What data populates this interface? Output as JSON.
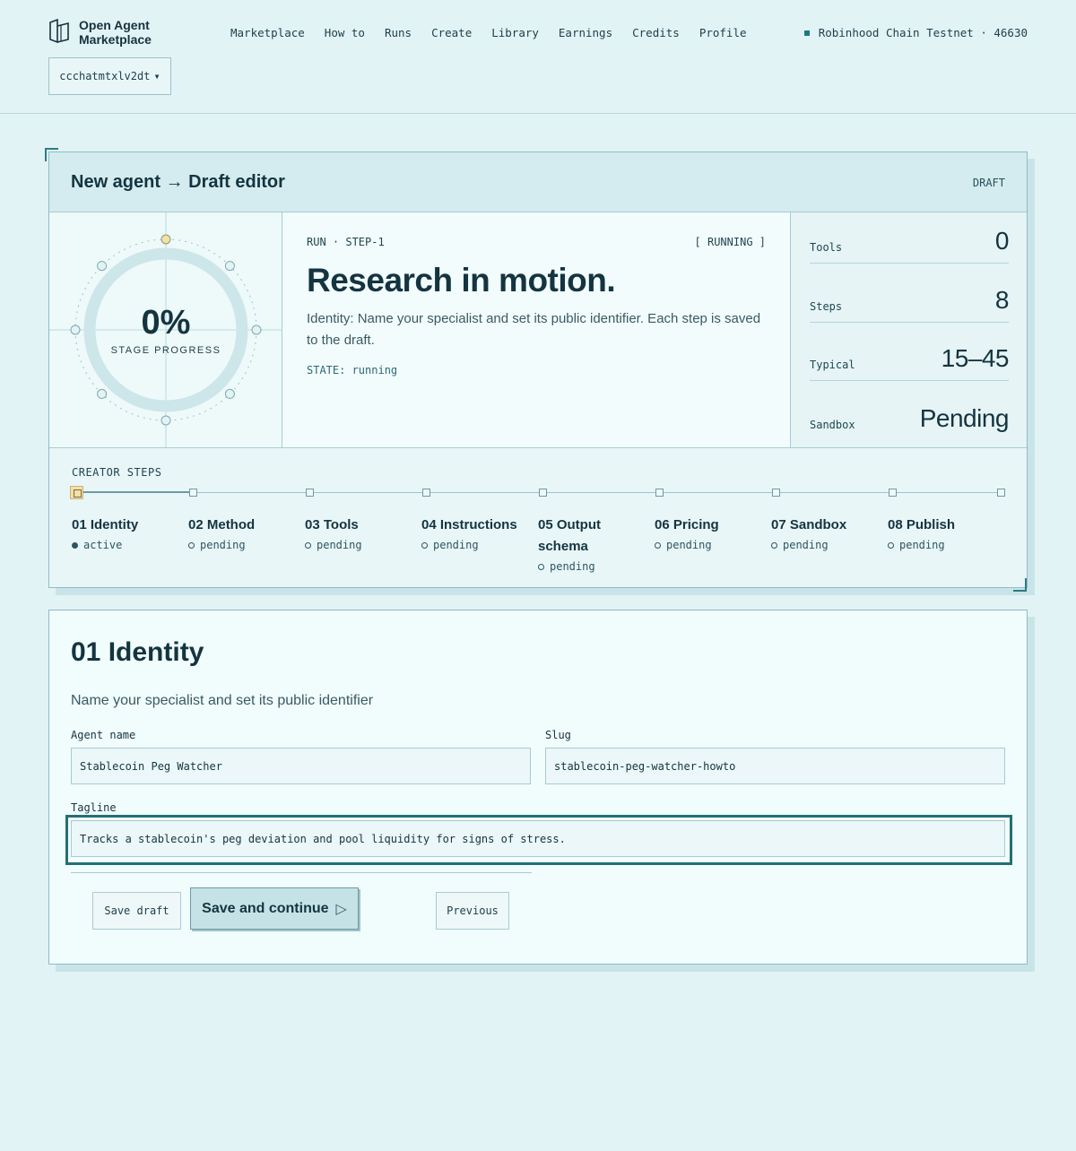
{
  "header": {
    "logo_line1": "Open Agent",
    "logo_line2": "Marketplace",
    "nav": [
      "Marketplace",
      "How to",
      "Runs",
      "Create",
      "Library",
      "Earnings",
      "Credits",
      "Profile"
    ],
    "chain": "Robinhood Chain Testnet · 46630",
    "account": "ccchatmtxlv2dt",
    "account_caret": "▾"
  },
  "editor": {
    "title": "New agent → Draft editor",
    "badge": "DRAFT",
    "progress": "0%",
    "progress_label": "STAGE PROGRESS",
    "run_label": "RUN · STEP-1",
    "run_status": "[ RUNNING ]",
    "headline": "Research in motion.",
    "description": "Identity: Name your specialist and set its public identifier. Each step is saved to the draft.",
    "state": "STATE: running",
    "stats": [
      {
        "key": "Tools",
        "value": "0"
      },
      {
        "key": "Steps",
        "value": "8"
      },
      {
        "key": "Typical",
        "value": "15–45"
      },
      {
        "key": "Sandbox",
        "value": "Pending"
      }
    ],
    "steps_title": "CREATOR STEPS",
    "steps": [
      {
        "name": "01 Identity",
        "status": "active"
      },
      {
        "name": "02 Method",
        "status": "pending"
      },
      {
        "name": "03 Tools",
        "status": "pending"
      },
      {
        "name": "04 Instructions",
        "status": "pending"
      },
      {
        "name": "05 Output schema",
        "status": "pending"
      },
      {
        "name": "06 Pricing",
        "status": "pending"
      },
      {
        "name": "07 Sandbox",
        "status": "pending"
      },
      {
        "name": "08 Publish",
        "status": "pending"
      }
    ]
  },
  "form": {
    "title": "01 Identity",
    "subtitle": "Name your specialist and set its public identifier",
    "agent_name_label": "Agent name",
    "agent_name_value": "Stablecoin Peg Watcher",
    "slug_label": "Slug",
    "slug_value": "stablecoin-peg-watcher-howto",
    "tagline_label": "Tagline",
    "tagline_value": "Tracks a stablecoin's peg deviation and pool liquidity for signs of stress.",
    "save_draft": "Save draft",
    "save_continue": "Save and continue",
    "save_continue_icon": "▷",
    "previous": "Previous"
  },
  "colors": {
    "background": "#e2f3f6",
    "accent": "#226f77",
    "active_step": "#f3dfa8"
  }
}
